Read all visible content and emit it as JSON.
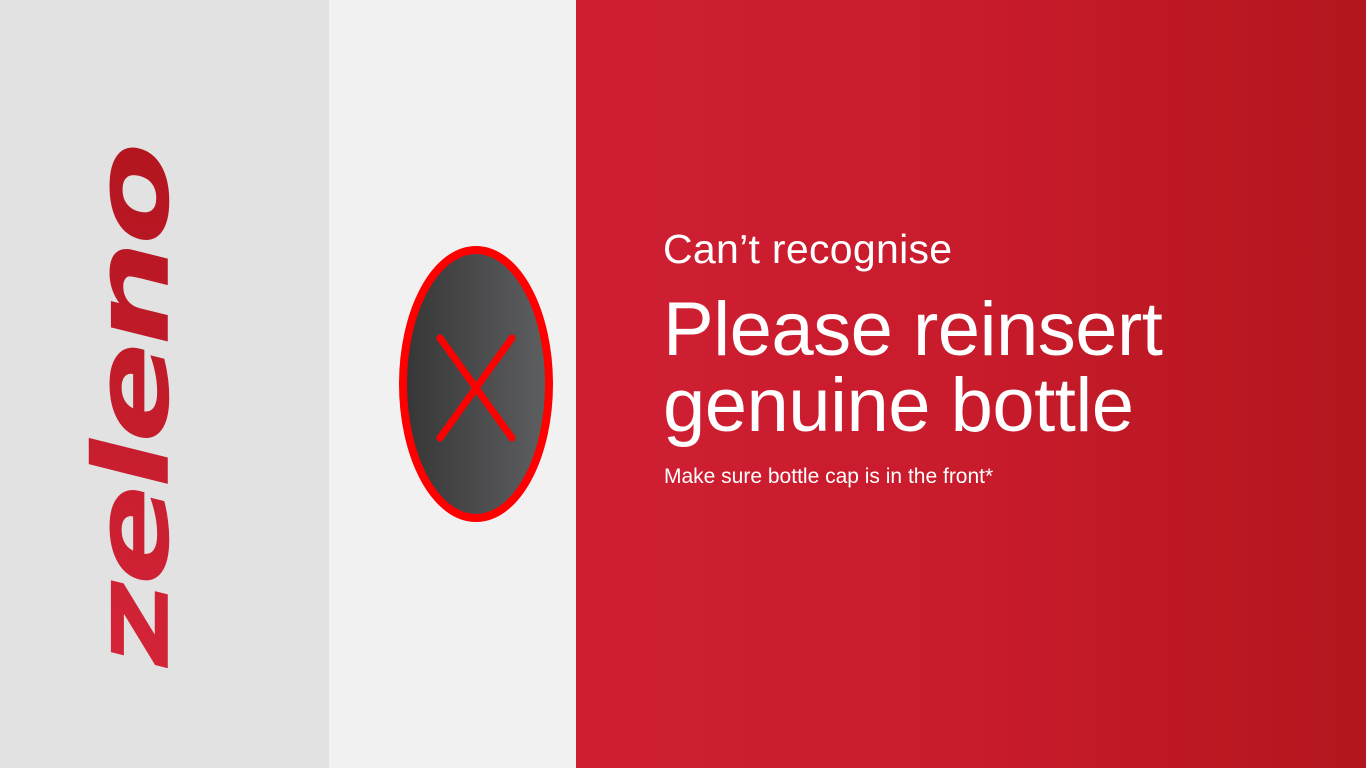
{
  "brand": {
    "name": "zeleno",
    "color": "#c81e2c"
  },
  "status": {
    "icon": "x-cross-icon",
    "error_color": "#ff0000"
  },
  "message": {
    "title": "Can’t recognise",
    "main_line_1": "Please reinsert",
    "main_line_2": "genuine bottle",
    "note": "Make sure bottle cap is in the front*"
  },
  "colors": {
    "left_panel": "#e2e2e2",
    "middle_panel": "#f1f1f1",
    "right_panel_start": "#d01f33",
    "right_panel_end": "#b4161d",
    "text": "#ffffff"
  }
}
